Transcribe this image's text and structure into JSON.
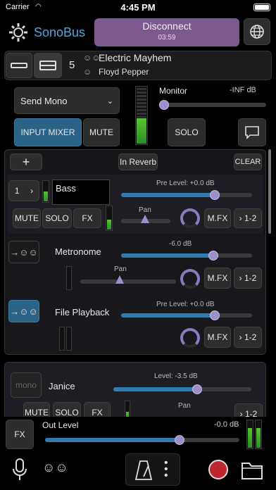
{
  "status": {
    "carrier": "Carrier",
    "time": "4:45 PM"
  },
  "header": {
    "app_name": "SonoBus",
    "disconnect_label": "Disconnect",
    "disconnect_time": "03:59"
  },
  "group": {
    "count": "5",
    "name": "Electric Mayhem",
    "user": "Floyd Pepper"
  },
  "controls": {
    "send_mode": "Send Mono",
    "monitor_label": "Monitor",
    "monitor_value": "-INF dB",
    "input_mixer": "INPUT MIXER",
    "mute": "MUTE",
    "solo": "SOLO"
  },
  "mixer": {
    "add": "+",
    "reverb": "In Reverb",
    "clear": "CLEAR",
    "channels": [
      {
        "number": "1",
        "name": "Bass",
        "level_label": "Pre Level: +0.0 dB",
        "level": 0.78,
        "pan_label": "Pan",
        "mute": "MUTE",
        "solo": "SOLO",
        "fx": "FX",
        "mfx": "M.FX",
        "route": "1-2"
      },
      {
        "name": "Metronome",
        "level_label": "-6.0 dB",
        "level": 0.7,
        "pan_label": "Pan",
        "mfx": "M.FX",
        "route": "1-2"
      },
      {
        "name": "File Playback",
        "level_label": "Pre Level: +0.0 dB",
        "level": 0.78,
        "mfx": "M.FX",
        "route": "1-2"
      }
    ]
  },
  "peer": {
    "mono": "mono",
    "name": "Janice",
    "level_label": "Level: -3.5 dB",
    "level": 0.72,
    "pan_label": "Pan",
    "mute": "MUTE",
    "solo": "SOLO",
    "fx": "FX",
    "route": "1-2"
  },
  "output": {
    "fx": "FX",
    "label": "Out Level",
    "value": "-0.0 dB",
    "level": 0.8
  },
  "colors": {
    "accent": "#2f7db0",
    "thumb": "#9f8fc9",
    "disconnect": "#7c5a8f",
    "record": "#c0262d",
    "active_blue": "#2b6387"
  }
}
